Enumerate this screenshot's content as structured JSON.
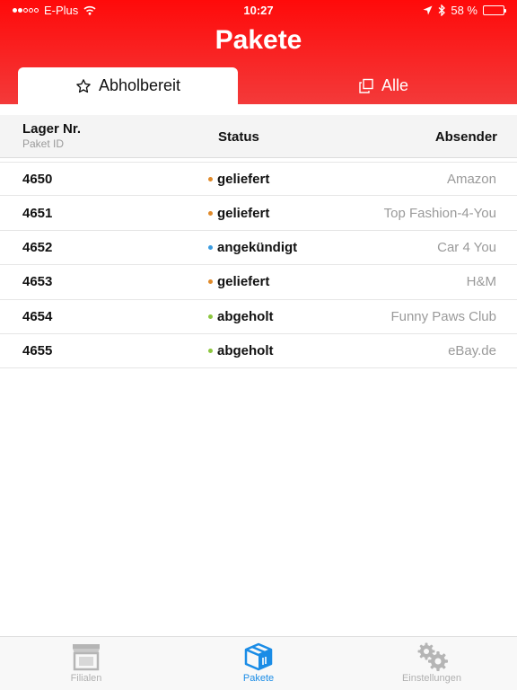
{
  "status_bar": {
    "carrier": "E-Plus",
    "time": "10:27",
    "battery_percent": "58 %",
    "battery_level": 0.58
  },
  "header": {
    "title": "Pakete",
    "tabs": [
      {
        "label": "Abholbereit",
        "icon": "star-icon",
        "active": true
      },
      {
        "label": "Alle",
        "icon": "copy-icon",
        "active": false
      }
    ]
  },
  "table": {
    "columns": {
      "storage": "Lager Nr.",
      "storage_sub": "Paket ID",
      "status": "Status",
      "sender": "Absender"
    },
    "rows": [
      {
        "id": "4650",
        "status": "geliefert",
        "status_color": "#e08a2a",
        "sender": "Amazon"
      },
      {
        "id": "4651",
        "status": "geliefert",
        "status_color": "#e08a2a",
        "sender": "Top Fashion-4-You"
      },
      {
        "id": "4652",
        "status": "angekündigt",
        "status_color": "#3a9be0",
        "sender": "Car 4 You"
      },
      {
        "id": "4653",
        "status": "geliefert",
        "status_color": "#e08a2a",
        "sender": "H&M"
      },
      {
        "id": "4654",
        "status": "abgeholt",
        "status_color": "#8cc63f",
        "sender": "Funny Paws Club"
      },
      {
        "id": "4655",
        "status": "abgeholt",
        "status_color": "#8cc63f",
        "sender": "eBay.de"
      }
    ]
  },
  "tab_bar": {
    "items": [
      {
        "label": "Filialen",
        "icon": "store-icon",
        "active": false
      },
      {
        "label": "Pakete",
        "icon": "package-icon",
        "active": true
      },
      {
        "label": "Einstellungen",
        "icon": "gears-icon",
        "active": false
      }
    ]
  },
  "colors": {
    "brand_red": "#ff0a0a",
    "active_blue": "#1a8ce6"
  }
}
